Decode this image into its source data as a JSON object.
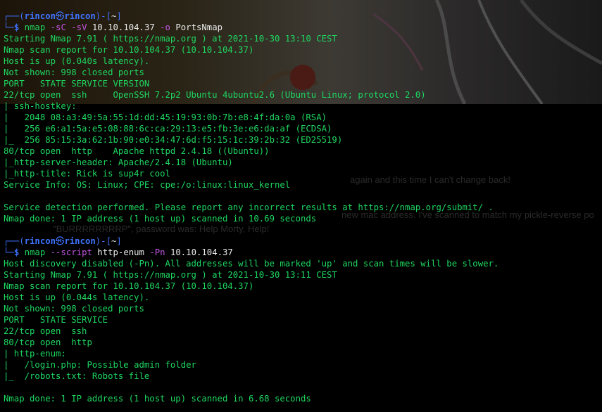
{
  "background": {
    "ghost_line_1": "again and this time I can't change back!",
    "ghost_line_2": "new mac address. I've scanned to match my pickle-reverse po",
    "ghost_line_3": "\"BURRRRRRRRP\", password was: Help Morty, Help!"
  },
  "prompt1": {
    "top": "┌──(",
    "user": "rincon",
    "at": "㉿",
    "host": "rincon",
    "close": ")-[",
    "dir": "~",
    "end": "]",
    "bottom": "└─",
    "symbol": "$ ",
    "cmd": "nmap ",
    "flag1": "-sC ",
    "flag2": "-sV ",
    "target": "10.10.104.37 ",
    "flag3": "-o ",
    "outfile": "PortsNmap"
  },
  "output1": [
    "Starting Nmap 7.91 ( https://nmap.org ) at 2021-10-30 13:10 CEST",
    "Nmap scan report for 10.10.104.37 (10.10.104.37)",
    "Host is up (0.040s latency).",
    "Not shown: 998 closed ports",
    "PORT   STATE SERVICE VERSION",
    "22/tcp open  ssh     OpenSSH 7.2p2 Ubuntu 4ubuntu2.6 (Ubuntu Linux; protocol 2.0)",
    "| ssh-hostkey: ",
    "|   2048 08:a3:49:5a:55:1d:dd:45:19:93:0b:7b:e8:4f:da:0a (RSA)",
    "|   256 e6:a1:5a:e5:08:88:6c:ca:29:13:e5:fb:3e:e6:da:af (ECDSA)",
    "|_  256 85:15:3a:62:1b:90:e0:34:47:6d:f5:15:1c:39:2b:32 (ED25519)",
    "80/tcp open  http    Apache httpd 2.4.18 ((Ubuntu))",
    "|_http-server-header: Apache/2.4.18 (Ubuntu)",
    "|_http-title: Rick is sup4r cool",
    "Service Info: OS: Linux; CPE: cpe:/o:linux:linux_kernel",
    "",
    "Service detection performed. Please report any incorrect results at https://nmap.org/submit/ .",
    "Nmap done: 1 IP address (1 host up) scanned in 10.69 seconds",
    ""
  ],
  "prompt2": {
    "top": "┌──(",
    "user": "rincon",
    "at": "㉿",
    "host": "rincon",
    "close": ")-[",
    "dir": "~",
    "end": "]",
    "bottom": "└─",
    "symbol": "$ ",
    "cmd": "nmap ",
    "flag1": "--script ",
    "script": "http-enum ",
    "flag2": "-Pn ",
    "target": "10.10.104.37"
  },
  "output2": [
    "Host discovery disabled (-Pn). All addresses will be marked 'up' and scan times will be slower.",
    "Starting Nmap 7.91 ( https://nmap.org ) at 2021-10-30 13:11 CEST",
    "Nmap scan report for 10.10.104.37 (10.10.104.37)",
    "Host is up (0.044s latency).",
    "Not shown: 998 closed ports",
    "PORT   STATE SERVICE",
    "22/tcp open  ssh",
    "80/tcp open  http",
    "| http-enum: ",
    "|   /login.php: Possible admin folder",
    "|_  /robots.txt: Robots file",
    "",
    "Nmap done: 1 IP address (1 host up) scanned in 6.68 seconds"
  ]
}
